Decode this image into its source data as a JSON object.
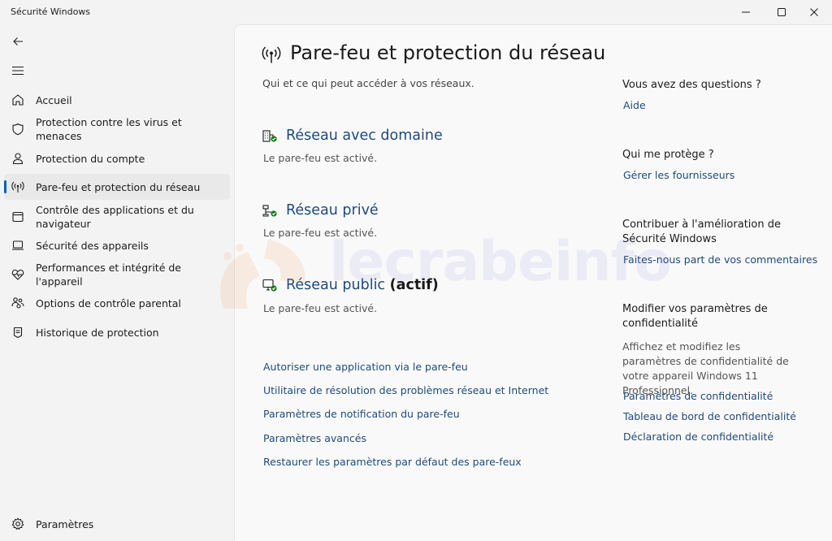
{
  "window": {
    "title": "Sécurité Windows",
    "controls": [
      "minimize",
      "maximize",
      "close"
    ]
  },
  "sidebar": {
    "back_icon": "back-arrow-icon",
    "menu_icon": "hamburger-menu-icon",
    "items": [
      {
        "label": "Accueil",
        "icon": "home-icon"
      },
      {
        "label": "Protection contre les virus et menaces",
        "icon": "shield-icon"
      },
      {
        "label": "Protection du compte",
        "icon": "person-icon"
      },
      {
        "label": "Pare-feu et protection du réseau",
        "icon": "antenna-icon",
        "selected": true
      },
      {
        "label": "Contrôle des applications et du navigateur",
        "icon": "browser-window-icon"
      },
      {
        "label": "Sécurité des appareils",
        "icon": "laptop-icon"
      },
      {
        "label": "Performances et intégrité de l'appareil",
        "icon": "heart-pulse-icon"
      },
      {
        "label": "Options de contrôle parental",
        "icon": "family-icon"
      },
      {
        "label": "Historique de protection",
        "icon": "history-icon"
      }
    ],
    "settings": {
      "label": "Paramètres",
      "icon": "gear-icon"
    }
  },
  "main": {
    "title": "Pare-feu et protection du réseau",
    "subtitle": "Qui et ce qui peut accéder à vos réseaux.",
    "networks": [
      {
        "title": "Réseau avec domaine",
        "active_label": "",
        "status": "Le pare-feu est activé.",
        "icon": "domain-network-icon"
      },
      {
        "title": "Réseau privé",
        "active_label": "",
        "status": "Le pare-feu est activé.",
        "icon": "private-network-icon"
      },
      {
        "title": "Réseau public",
        "active_label": "(actif)",
        "status": "Le pare-feu est activé.",
        "icon": "public-network-icon"
      }
    ],
    "links": [
      "Autoriser une application via le pare-feu",
      "Utilitaire de résolution des problèmes réseau et Internet",
      "Paramètres de notification du pare-feu",
      "Paramètres avancés",
      "Restaurer les paramètres par défaut des pare-feux"
    ]
  },
  "aside": {
    "questions": {
      "heading": "Vous avez des questions ?",
      "link": "Aide"
    },
    "protector": {
      "heading": "Qui me protège ?",
      "link": "Gérer les fournisseurs"
    },
    "contribute": {
      "heading": "Contribuer à l'amélioration de Sécurité Windows",
      "link": "Faites-nous part de vos commentaires"
    },
    "privacy": {
      "heading": "Modifier vos paramètres de confidentialité",
      "text": "Affichez et modifiez les paramètres de confidentialité de votre appareil Windows 11 Professionnel.",
      "links": [
        "Paramètres de confidentialité",
        "Tableau de bord de confidentialité",
        "Déclaration de confidentialité"
      ]
    }
  },
  "watermark": {
    "text": "lecrabeinfo"
  },
  "colors": {
    "accent": "#005fb8",
    "link": "#1f4a7c",
    "status_ok": "#107c10"
  }
}
